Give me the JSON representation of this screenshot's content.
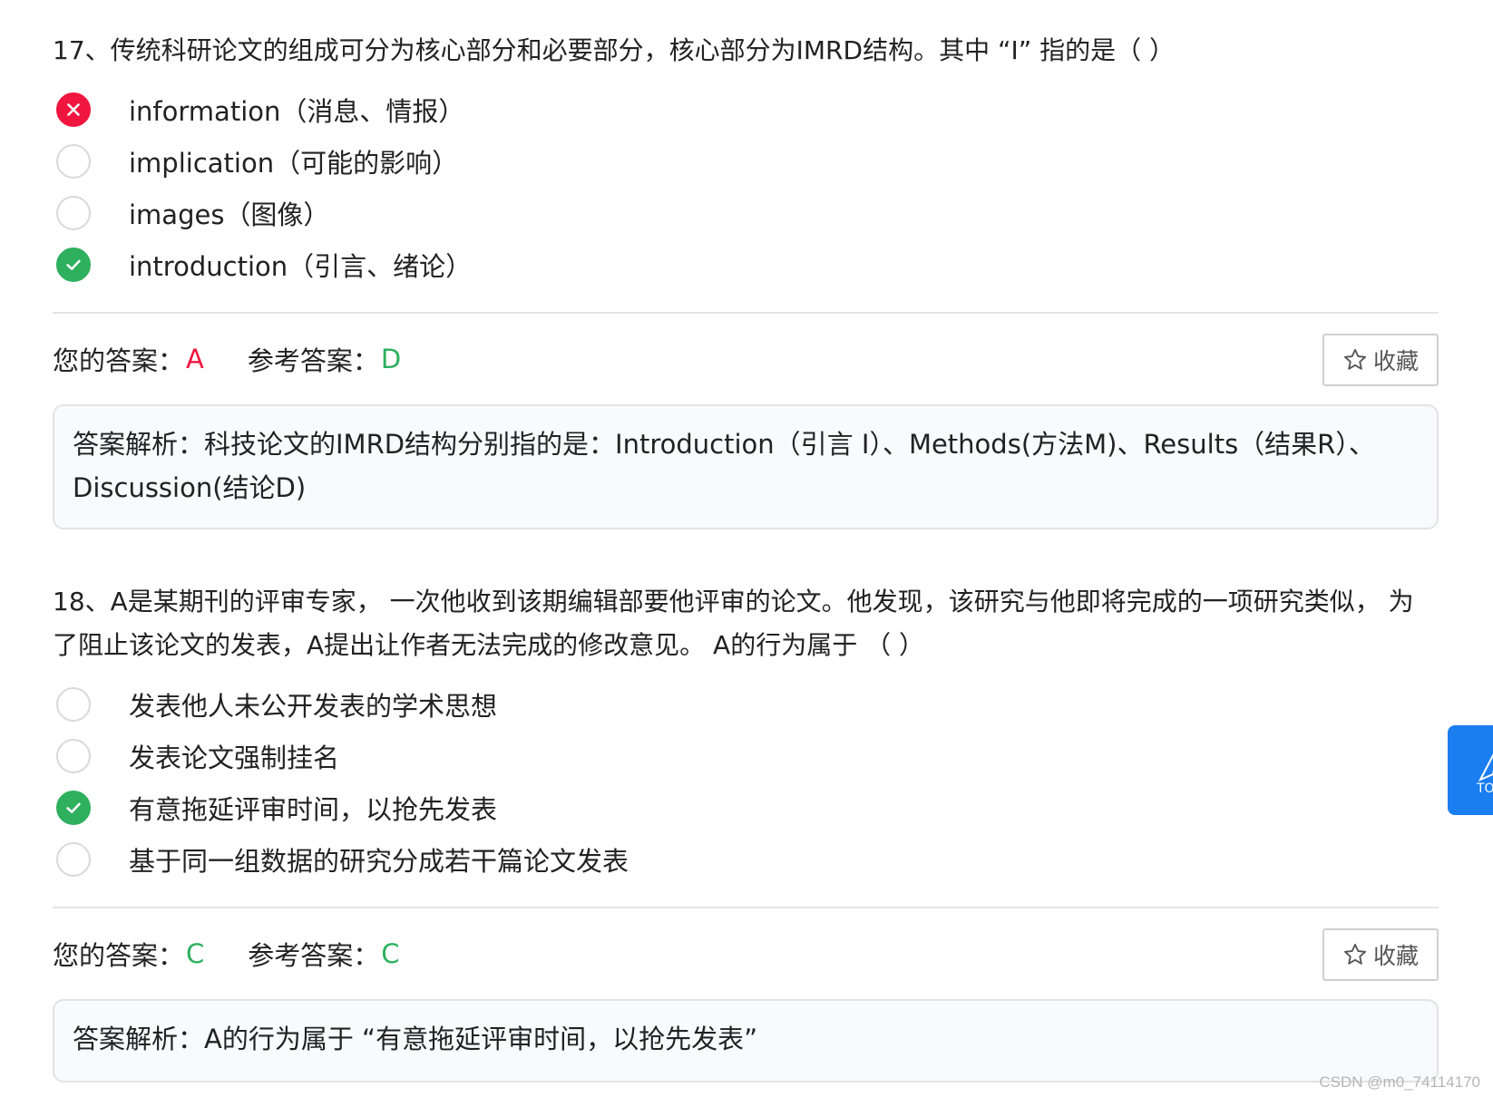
{
  "questions": [
    {
      "title": "17、传统科研论文的组成可分为核心部分和必要部分，核心部分为IMRD结构。其中 “I” 指的是（ ）",
      "options": [
        {
          "text": "information（消息、情报）",
          "state": "wrong"
        },
        {
          "text": "implication（可能的影响）",
          "state": "empty"
        },
        {
          "text": "images（图像）",
          "state": "empty"
        },
        {
          "text": "introduction（引言、绪论）",
          "state": "correct"
        }
      ],
      "your_answer_label": "您的答案：",
      "your_answer": "A",
      "reference_label": "参考答案：",
      "reference_answer": "D",
      "favorite_label": "收藏",
      "analysis": "答案解析：科技论文的IMRD结构分别指的是：Introduction（引言 I）、Methods(方法M)、Results（结果R）、Discussion(结论D)"
    },
    {
      "title": "18、A是某期刊的评审专家， 一次他收到该期编辑部要他评审的论文。他发现，该研究与他即将完成的一项研究类似， 为了阻止该论文的发表，A提出让作者无法完成的修改意见。 A的行为属于 （ ）",
      "options": [
        {
          "text": "发表他人未公开发表的学术思想",
          "state": "empty"
        },
        {
          "text": "发表论文强制挂名",
          "state": "empty"
        },
        {
          "text": "有意拖延评审时间，以抢先发表",
          "state": "correct"
        },
        {
          "text": "基于同一组数据的研究分成若干篇论文发表",
          "state": "empty"
        }
      ],
      "your_answer_label": "您的答案：",
      "your_answer": "C",
      "reference_label": "参考答案：",
      "reference_answer": "C",
      "favorite_label": "收藏",
      "analysis": "答案解析：A的行为属于 “有意拖延评审时间，以抢先发表”"
    }
  ],
  "back_to_top_label": "TO",
  "watermark": "CSDN @m0_74114170",
  "colors": {
    "wrong": "#f0163f",
    "correct": "#2eb05e",
    "accent": "#1a7df0"
  }
}
